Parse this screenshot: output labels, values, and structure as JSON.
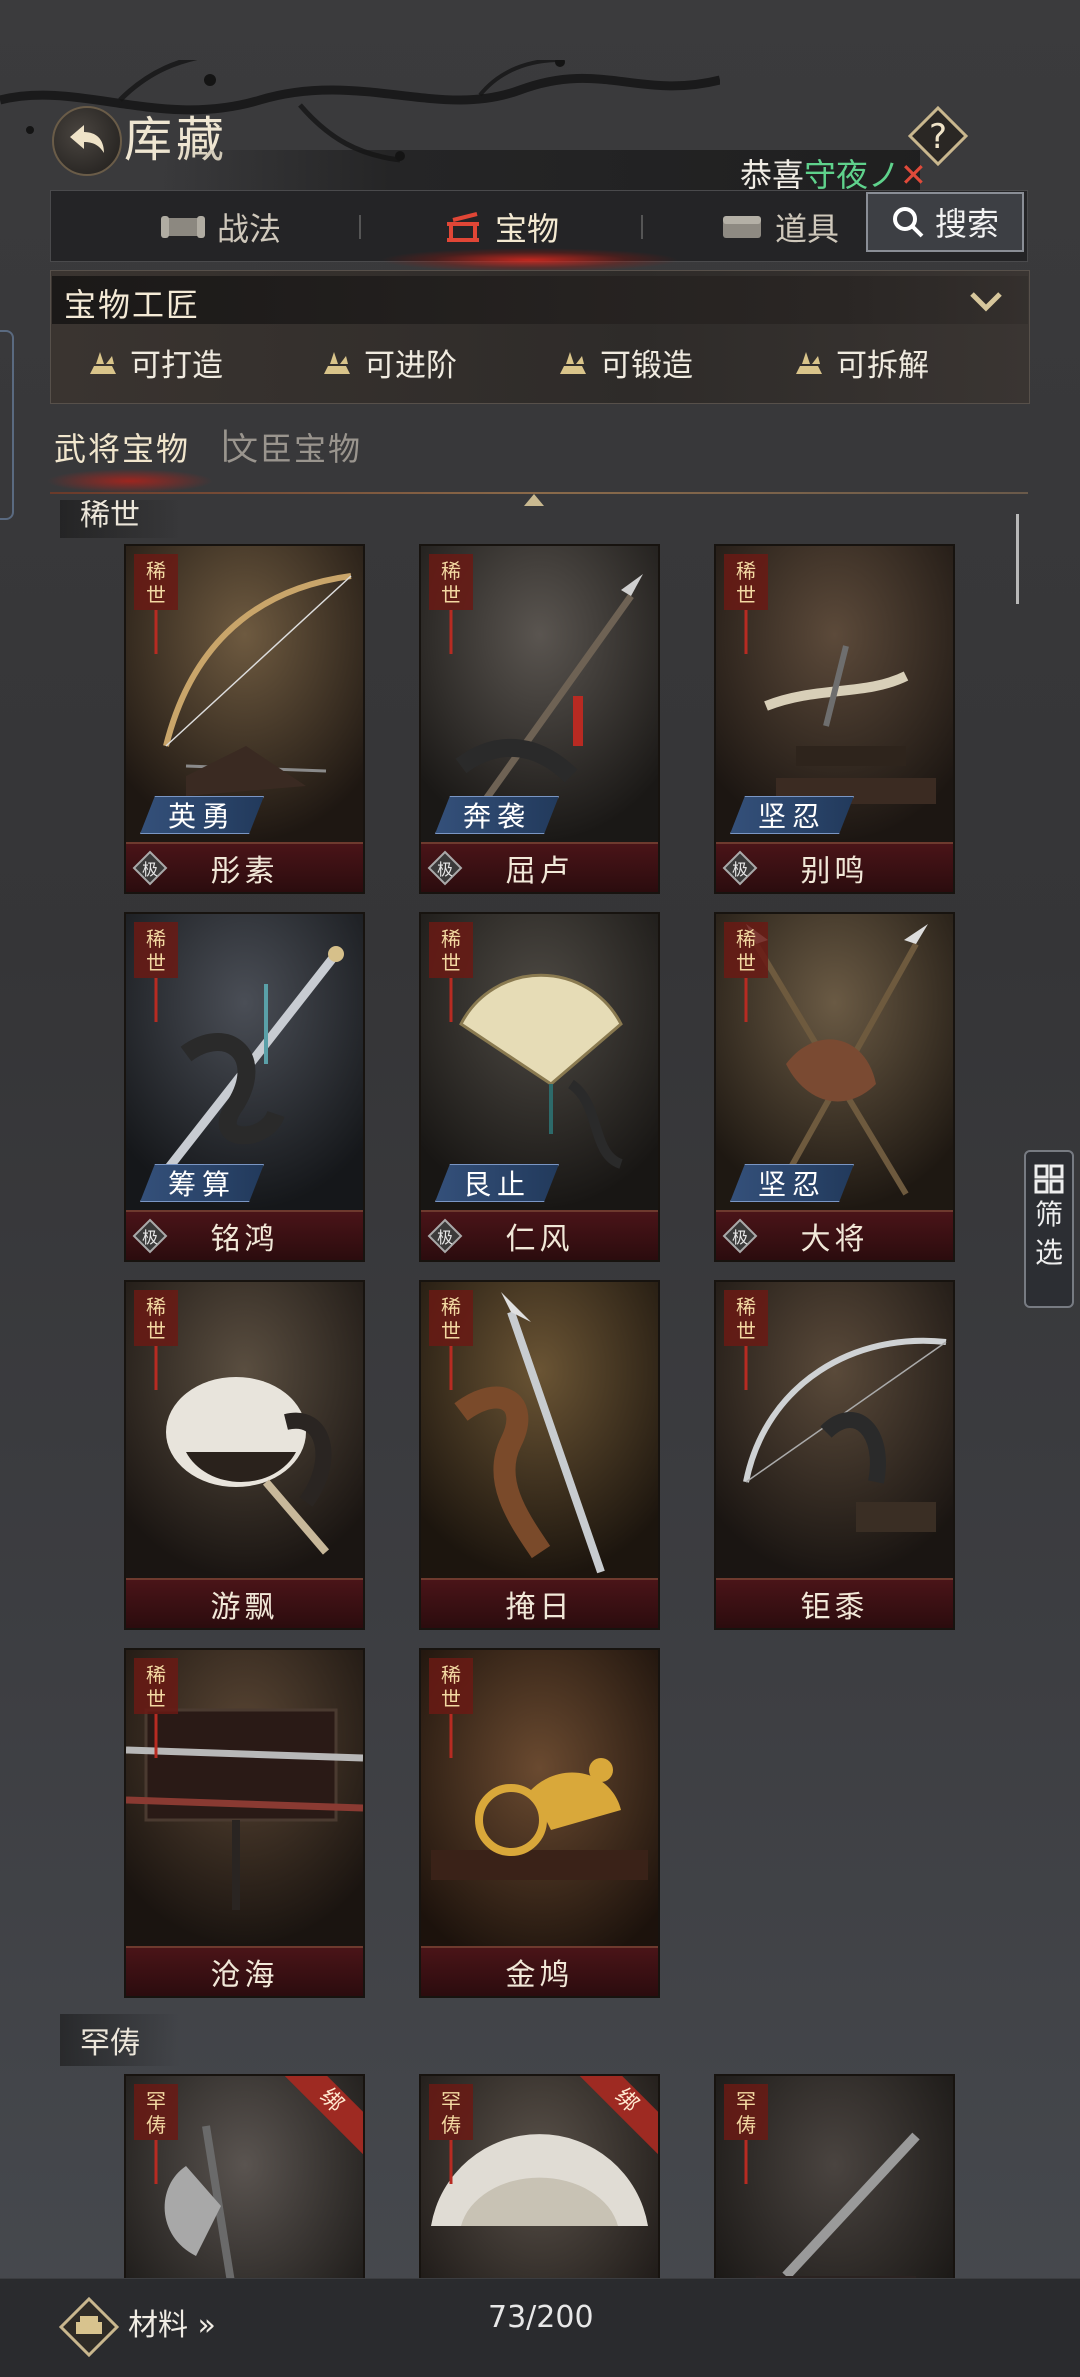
{
  "header": {
    "title": "库藏",
    "notice_prefix": "恭喜",
    "notice_name": "守夜ノ",
    "notice_close": "✕"
  },
  "tabs": [
    {
      "label": "战法",
      "active": false
    },
    {
      "label": "宝物",
      "active": true
    },
    {
      "label": "道具",
      "active": false
    }
  ],
  "search": {
    "label": "搜索"
  },
  "craftsman": {
    "title": "宝物工匠",
    "options": [
      {
        "label": "可打造"
      },
      {
        "label": "可进阶"
      },
      {
        "label": "可锻造"
      },
      {
        "label": "可拆解"
      }
    ]
  },
  "subtabs": [
    {
      "label": "武将宝物",
      "active": true
    },
    {
      "label": "文臣宝物",
      "active": false
    }
  ],
  "sections": {
    "rare_label": "稀世",
    "uncommon_label": "罕俦"
  },
  "treasures": [
    {
      "name": "彤素",
      "trait": "英勇",
      "grade": "极"
    },
    {
      "name": "屈卢",
      "trait": "奔袭",
      "grade": "极"
    },
    {
      "name": "别鸣",
      "trait": "坚忍",
      "grade": "极"
    },
    {
      "name": "铭鸿",
      "trait": "筹算",
      "grade": "极"
    },
    {
      "name": "仁风",
      "trait": "艮止",
      "grade": "极"
    },
    {
      "name": "大将",
      "trait": "坚忍",
      "grade": "极"
    },
    {
      "name": "游飘"
    },
    {
      "name": "掩日"
    },
    {
      "name": "钜黍"
    },
    {
      "name": "沧海"
    },
    {
      "name": "金鸠"
    }
  ],
  "rarity_badges": {
    "rare": "稀世",
    "uncommon": "罕俦"
  },
  "bind_badge": "绑",
  "filter": {
    "label_1": "筛",
    "label_2": "选"
  },
  "bottom": {
    "materials_label": "材料 »",
    "count": "73/200"
  },
  "colors": {
    "accent_red": "#9e2a22",
    "trait_blue": "#34507a",
    "notice_green": "#5fd28c"
  }
}
